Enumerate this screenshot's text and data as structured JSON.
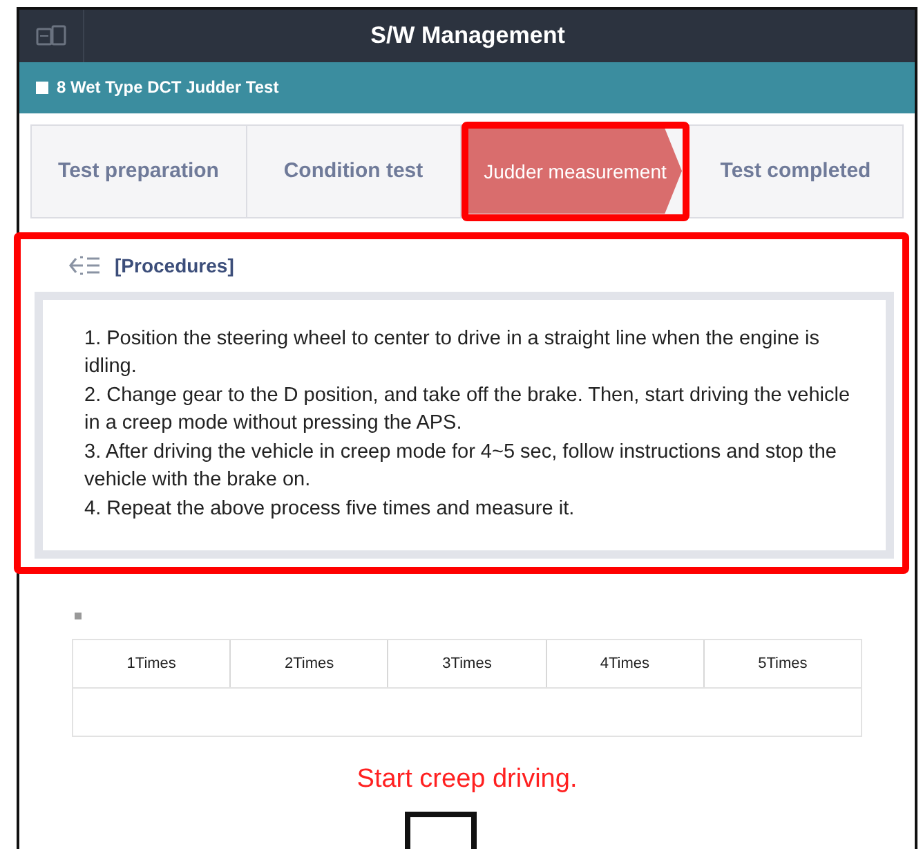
{
  "window": {
    "title": "S/W Management"
  },
  "test_bar": {
    "title": "8 Wet Type DCT Judder Test"
  },
  "steps": [
    {
      "label": "Test preparation",
      "selected": false,
      "highlighted": false
    },
    {
      "label": "Condition test",
      "selected": false,
      "highlighted": false
    },
    {
      "label": "Judder measurement",
      "selected": true,
      "highlighted": true
    },
    {
      "label": "Test completed",
      "selected": false,
      "highlighted": false
    }
  ],
  "procedures": {
    "title": "[Procedures]",
    "highlighted": true,
    "lines": [
      "1. Position the steering wheel to center to drive in a straight line when the engine is idling.",
      "2. Change gear to the D position, and take off the brake. Then, start driving the vehicle in a creep mode without pressing the APS.",
      "3. After driving the vehicle in creep mode for 4~5 sec, follow instructions and stop the vehicle with the brake on.",
      "4. Repeat the above process five times and measure it."
    ]
  },
  "table": {
    "columns": [
      "1Times",
      "2Times",
      "3Times",
      "4Times",
      "5Times"
    ]
  },
  "message": "Start creep driving."
}
